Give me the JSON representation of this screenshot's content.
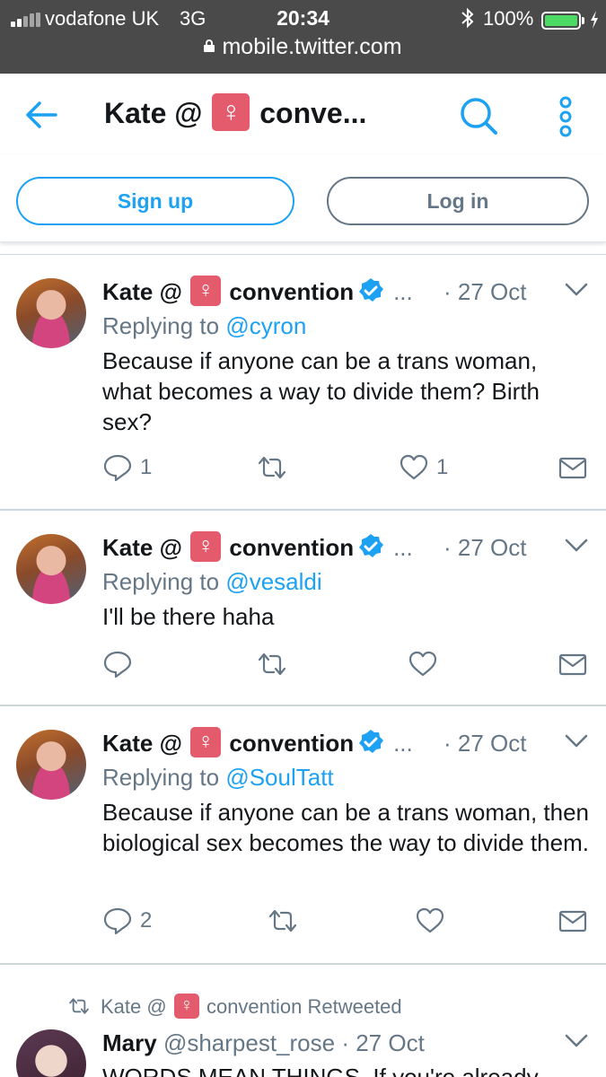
{
  "status_bar": {
    "carrier": "vodafone UK",
    "network": "3G",
    "time": "20:34",
    "battery_percent": "100%",
    "battery_level": 1.0,
    "url": "mobile.twitter.com"
  },
  "header": {
    "title_prefix": "Kate @",
    "venus_symbol": "♀",
    "title_suffix": "conve...",
    "back_icon": "back-arrow-icon",
    "search_icon": "search-icon",
    "more_icon": "more-vertical-icon"
  },
  "auth": {
    "signup_label": "Sign up",
    "login_label": "Log in"
  },
  "colors": {
    "accent": "#1da1f2",
    "muted": "#657786",
    "venus_badge": "#e35b6c",
    "status_bar": "#4a4a4a",
    "battery": "#4cd964"
  },
  "tweets": [
    {
      "name_prefix": "Kate @",
      "venus": "♀",
      "name_suffix": "convention",
      "ellipsis": "...",
      "date": "· 27 Oct",
      "replying_prefix": "Replying to",
      "reply_handle": "@cyron",
      "text": "Because if anyone can be a trans woman, what becomes a way to divide them? Birth sex?",
      "reply_count": "1",
      "retweet_count": "",
      "like_count": "1"
    },
    {
      "name_prefix": "Kate @",
      "venus": "♀",
      "name_suffix": "convention",
      "ellipsis": "...",
      "date": "· 27 Oct",
      "replying_prefix": "Replying to",
      "reply_handle": "@vesaldi",
      "text": "I'll be there haha",
      "reply_count": "",
      "retweet_count": "",
      "like_count": ""
    },
    {
      "name_prefix": "Kate @",
      "venus": "♀",
      "name_suffix": "convention",
      "ellipsis": "...",
      "date": "· 27 Oct",
      "replying_prefix": "Replying to",
      "reply_handle": "@SoulTatt",
      "text": "Because if anyone can be a trans woman, then biological sex becomes the way to divide them.",
      "reply_count": "2",
      "retweet_count": "",
      "like_count": ""
    }
  ],
  "retweet": {
    "rt_prefix": "Kate @",
    "venus": "♀",
    "rt_suffix": "convention Retweeted",
    "name": "Mary",
    "handle": "@sharpest_rose",
    "date": "· 27 Oct",
    "text_visible": "WORDS MEAN THINGS. If you're already"
  }
}
